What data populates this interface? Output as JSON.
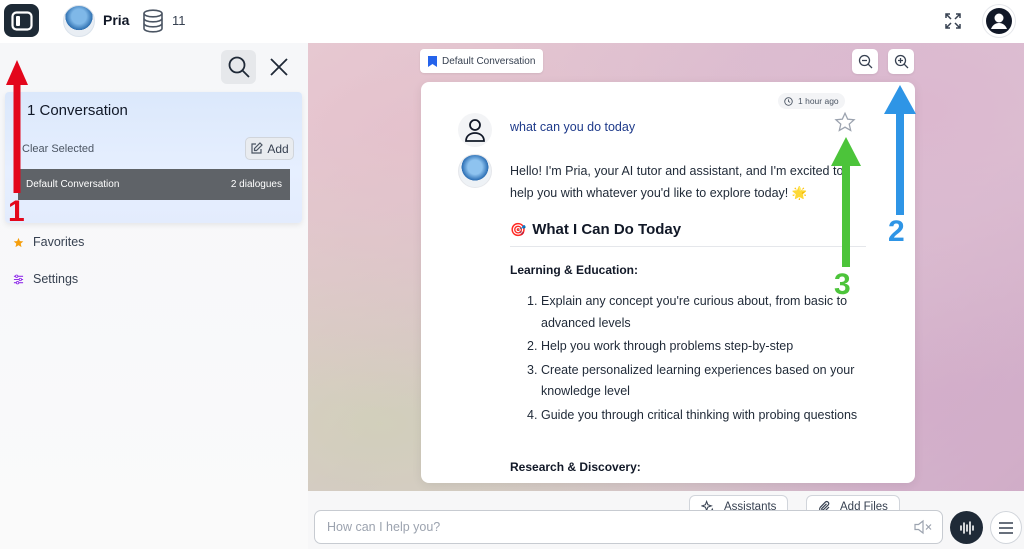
{
  "topbar": {
    "bot_name": "Pria",
    "db_count": "11"
  },
  "sidebar": {
    "conversation_count_title": "1 Conversation",
    "clear_selected": "Clear Selected",
    "add_label": "Add",
    "conversation": {
      "name": "Default Conversation",
      "dialogues": "2 dialogues"
    },
    "nav": [
      {
        "label": "Favorites",
        "icon": "star-icon"
      },
      {
        "label": "Settings",
        "icon": "sliders-icon"
      }
    ]
  },
  "chat": {
    "conversation_tag": "Default Conversation",
    "timestamp": "1 hour ago",
    "user_message": "what can you do today",
    "reply_intro": "Hello! I'm Pria, your AI tutor and assistant, and I'm excited to help you with whatever you'd like to explore today! 🌟",
    "section_heading": "What I Can Do Today",
    "section_emoji": "🎯",
    "learning_heading": "Learning & Education:",
    "learning_items": [
      "Explain any concept you're curious about, from basic to advanced levels",
      "Help you work through problems step-by-step",
      "Create personalized learning experiences based on your knowledge level",
      "Guide you through critical thinking with probing questions"
    ],
    "research_heading": "Research & Discovery:"
  },
  "bottom": {
    "assistants_label": "Assistants",
    "add_files_label": "Add Files",
    "input_placeholder": "How can I help you?"
  },
  "annotations": {
    "labels": [
      "1",
      "2",
      "3"
    ],
    "colors": {
      "1": "#e3071c",
      "2": "#2e95e6",
      "3": "#4cc43a"
    }
  },
  "colors": {
    "accent_dark": "#1e2a36",
    "selected_item": "#5f6368",
    "link_blue": "#1e3a8a"
  }
}
